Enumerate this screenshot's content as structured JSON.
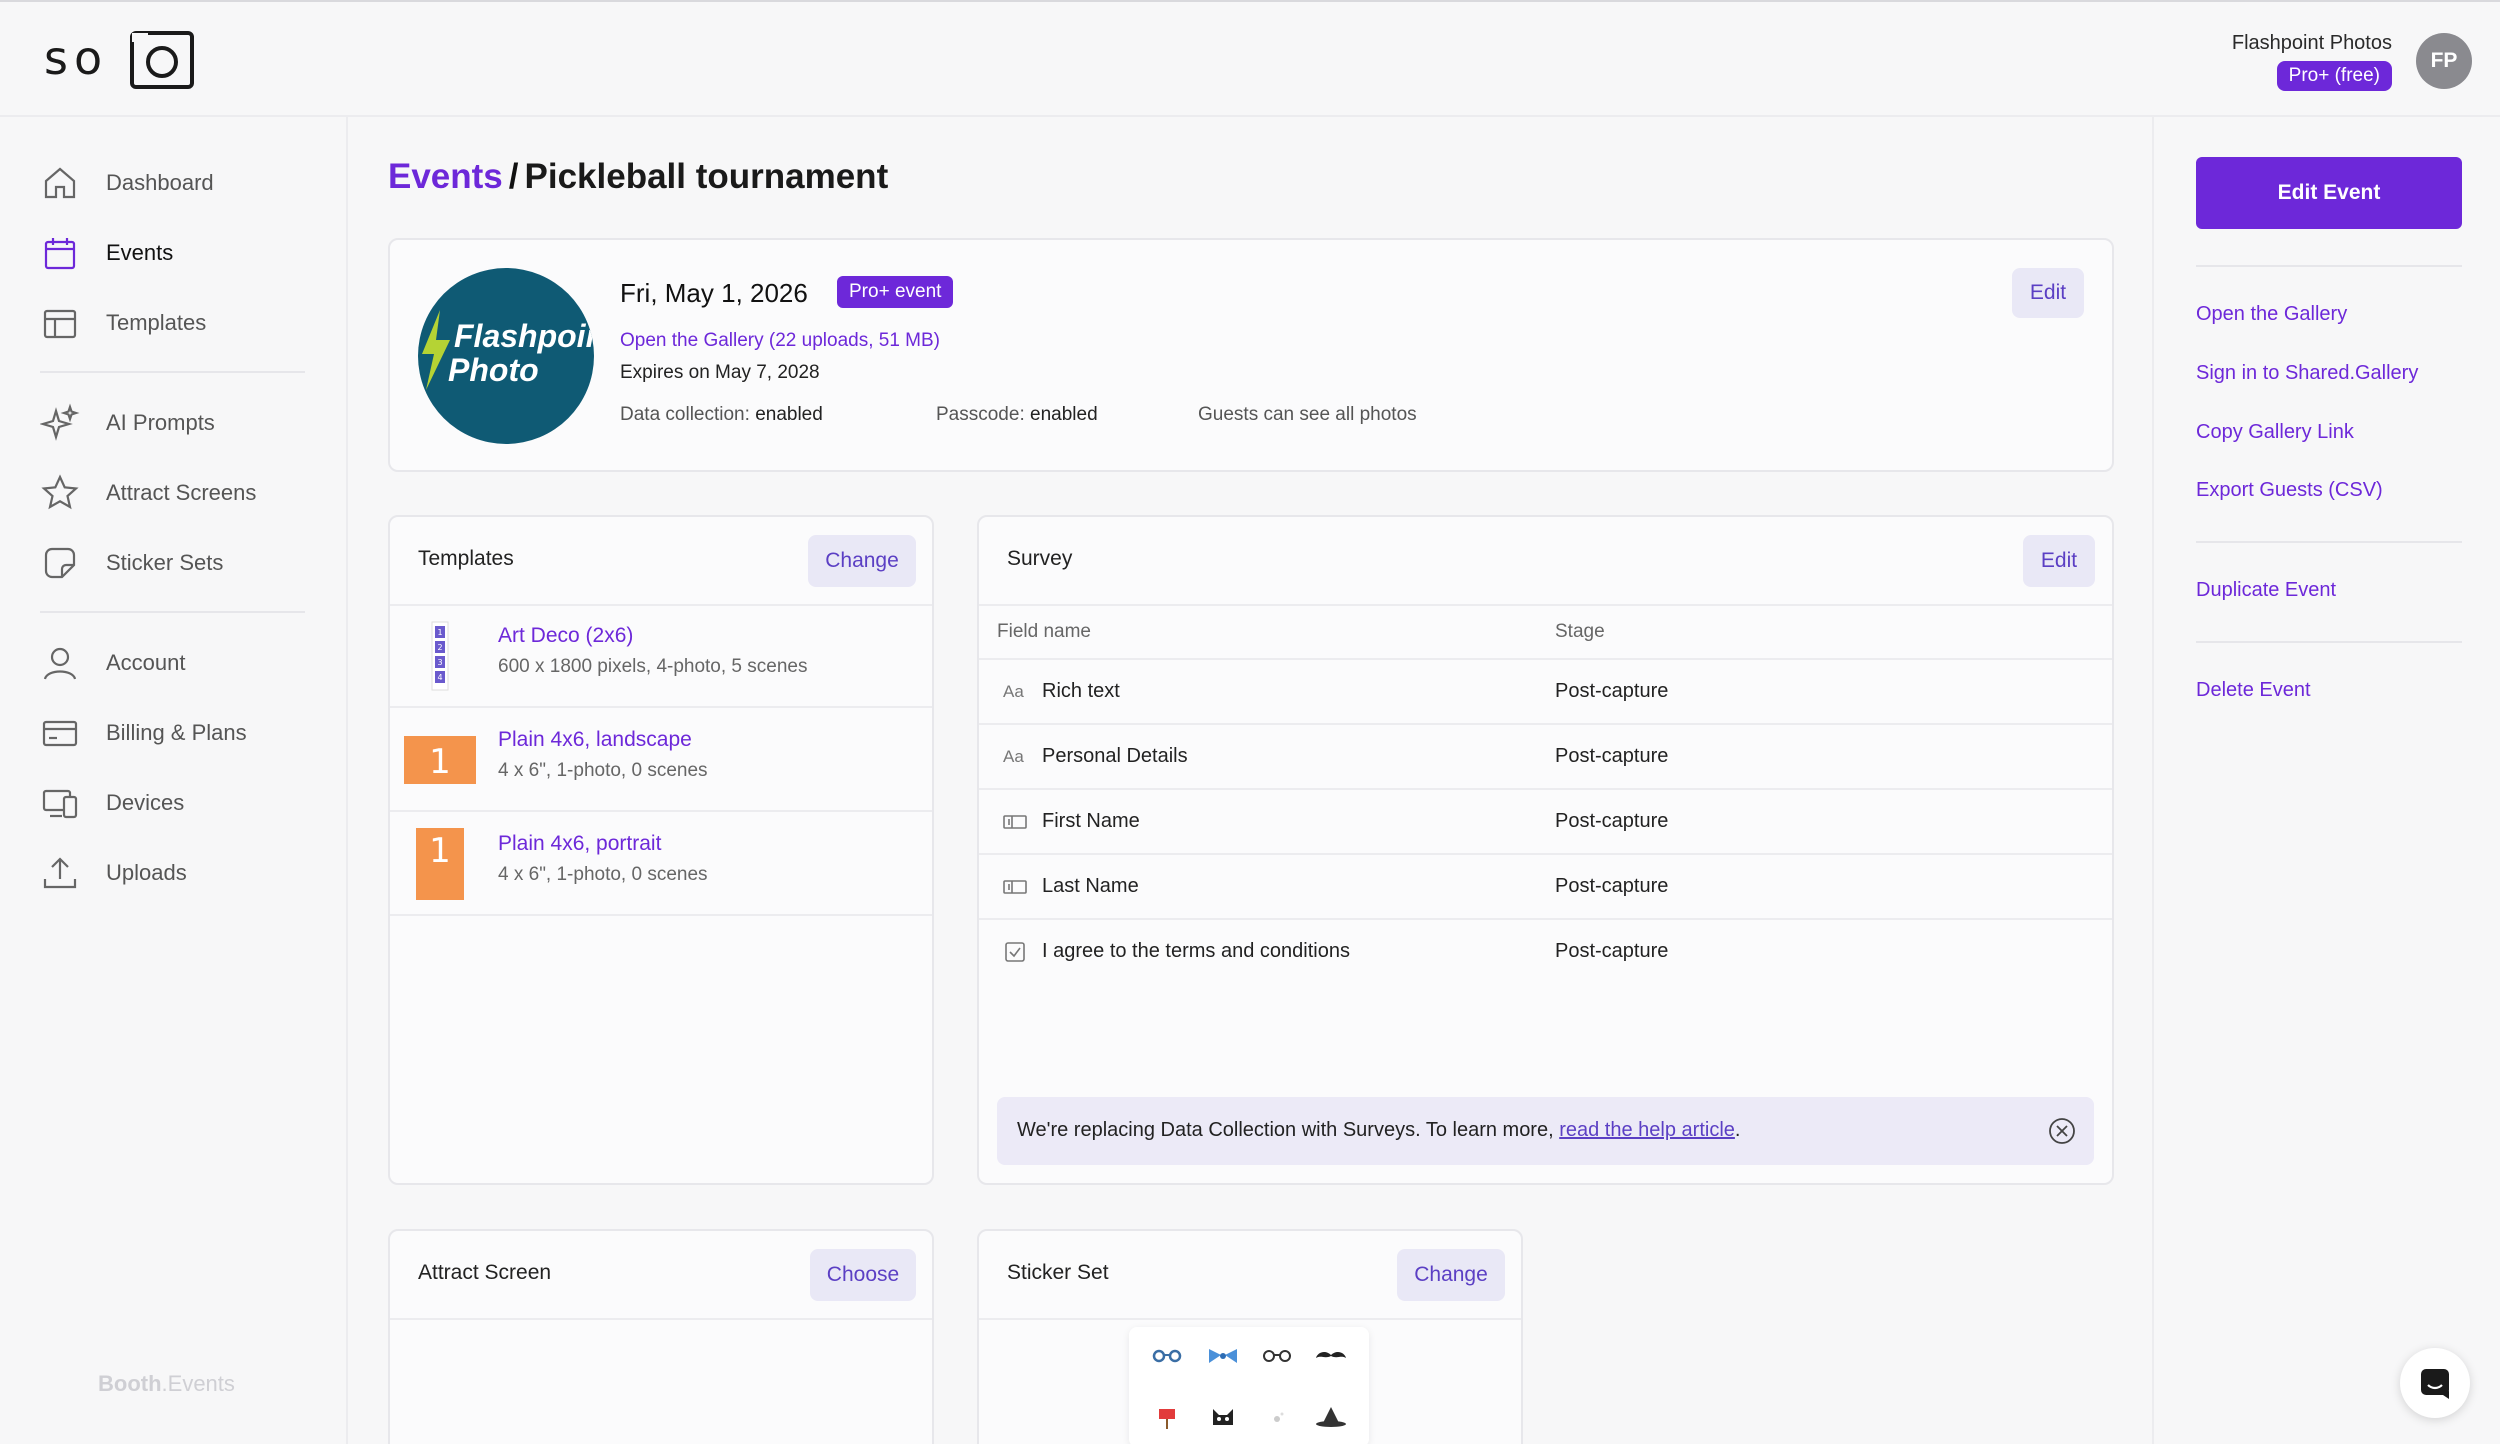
{
  "app": {
    "logo_text": "solo",
    "user_name": "Flashpoint Photos",
    "plan_badge": "Pro+ (free)",
    "avatar_initials": "FP",
    "footer_brand_bold": "Booth",
    "footer_brand_rest": ".Events"
  },
  "sidebar": {
    "items": [
      {
        "label": "Dashboard",
        "icon": "home-icon"
      },
      {
        "label": "Events",
        "icon": "calendar-icon",
        "active": true
      },
      {
        "label": "Templates",
        "icon": "layout-icon"
      },
      {
        "label": "AI Prompts",
        "icon": "sparkles-icon"
      },
      {
        "label": "Attract Screens",
        "icon": "star-icon"
      },
      {
        "label": "Sticker Sets",
        "icon": "sticker-icon"
      },
      {
        "label": "Account",
        "icon": "user-icon"
      },
      {
        "label": "Billing & Plans",
        "icon": "credit-card-icon"
      },
      {
        "label": "Devices",
        "icon": "devices-icon"
      },
      {
        "label": "Uploads",
        "icon": "upload-icon"
      }
    ]
  },
  "breadcrumb": {
    "parent": "Events",
    "separator": "/",
    "current": "Pickleball tournament"
  },
  "event": {
    "logo_line1": "Flashpoint",
    "logo_line2": "Photo",
    "date": "Fri, May 1, 2026",
    "badge": "Pro+ event",
    "gallery_link": "Open the Gallery (22 uploads, 51 MB)",
    "expires": "Expires on May 7, 2028",
    "data_collection_label": "Data collection:",
    "data_collection_value": "enabled",
    "passcode_label": "Passcode:",
    "passcode_value": "enabled",
    "guests_text": "Guests can see all photos",
    "edit_label": "Edit"
  },
  "templates": {
    "title": "Templates",
    "change_label": "Change",
    "items": [
      {
        "name": "Art Deco (2x6)",
        "desc": "600 x 1800 pixels, 4-photo, 5 scenes"
      },
      {
        "name": "Plain 4x6, landscape",
        "desc": "4 x 6\", 1-photo, 0 scenes"
      },
      {
        "name": "Plain 4x6, portrait",
        "desc": "4 x 6\", 1-photo, 0 scenes"
      }
    ],
    "thumb_numbers": [
      "1",
      "2",
      "3",
      "4"
    ],
    "plain_thumb_number": "1"
  },
  "survey": {
    "title": "Survey",
    "edit_label": "Edit",
    "columns": [
      "Field name",
      "Stage"
    ],
    "rows": [
      {
        "icon": "text-icon",
        "glyph": "Aa",
        "name": "Rich text",
        "stage": "Post-capture"
      },
      {
        "icon": "text-icon",
        "glyph": "Aa",
        "name": "Personal Details",
        "stage": "Post-capture"
      },
      {
        "icon": "input-field-icon",
        "glyph": "",
        "name": "First Name",
        "stage": "Post-capture"
      },
      {
        "icon": "input-field-icon",
        "glyph": "",
        "name": "Last Name",
        "stage": "Post-capture"
      },
      {
        "icon": "checkbox-icon",
        "glyph": "",
        "name": "I agree to the terms and conditions",
        "stage": "Post-capture"
      }
    ],
    "notice_text": "We're replacing Data Collection with Surveys. To learn more, ",
    "notice_link": "read the help article",
    "notice_end": "."
  },
  "attract_screen": {
    "title": "Attract Screen",
    "choose_label": "Choose"
  },
  "sticker_set": {
    "title": "Sticker Set",
    "change_label": "Change"
  },
  "right_panel": {
    "edit_event_label": "Edit Event",
    "links_group1": [
      "Open the Gallery",
      "Sign in to Shared.Gallery",
      "Copy Gallery Link",
      "Export Guests (CSV)"
    ],
    "links_group2": [
      "Duplicate Event"
    ],
    "links_group3": [
      "Delete Event"
    ]
  },
  "colors": {
    "accent": "#6d28d9",
    "soft_button_bg": "#e9e8f6",
    "event_logo_bg": "#0f5a74",
    "template_orange": "#f4944c"
  }
}
